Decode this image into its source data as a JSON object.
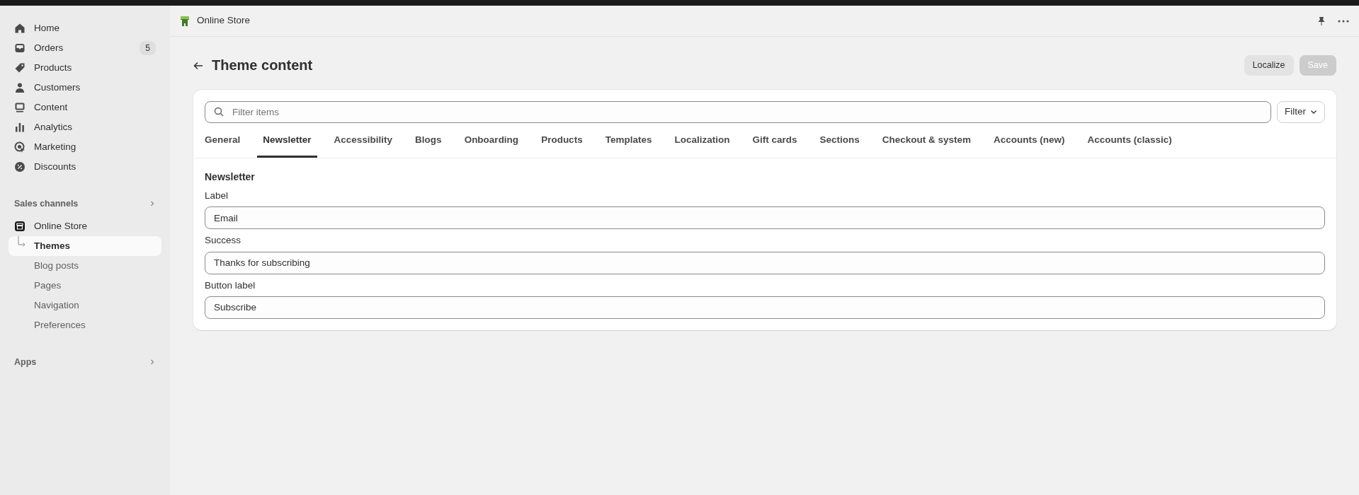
{
  "sidebar": {
    "items": [
      {
        "label": "Home"
      },
      {
        "label": "Orders",
        "badge": "5"
      },
      {
        "label": "Products"
      },
      {
        "label": "Customers"
      },
      {
        "label": "Content"
      },
      {
        "label": "Analytics"
      },
      {
        "label": "Marketing"
      },
      {
        "label": "Discounts"
      }
    ],
    "sections": [
      {
        "title": "Sales channels",
        "channels": [
          {
            "label": "Online Store",
            "children": [
              {
                "label": "Themes",
                "selected": true
              },
              {
                "label": "Blog posts",
                "selected": false
              },
              {
                "label": "Pages",
                "selected": false
              },
              {
                "label": "Navigation",
                "selected": false
              },
              {
                "label": "Preferences",
                "selected": false
              }
            ]
          }
        ]
      },
      {
        "title": "Apps"
      }
    ]
  },
  "topbar": {
    "title": "Online Store"
  },
  "page": {
    "title": "Theme content",
    "buttons": [
      {
        "label": "Localize",
        "disabled": false
      },
      {
        "label": "Save",
        "disabled": true
      }
    ]
  },
  "search": {
    "placeholder": "Filter items"
  },
  "filter_button": "Filter",
  "tabs": [
    {
      "label": "General",
      "selected": false
    },
    {
      "label": "Newsletter",
      "selected": true
    },
    {
      "label": "Accessibility",
      "selected": false
    },
    {
      "label": "Blogs",
      "selected": false
    },
    {
      "label": "Onboarding",
      "selected": false
    },
    {
      "label": "Products",
      "selected": false
    },
    {
      "label": "Templates",
      "selected": false
    },
    {
      "label": "Localization",
      "selected": false
    },
    {
      "label": "Gift cards",
      "selected": false
    },
    {
      "label": "Sections",
      "selected": false
    },
    {
      "label": "Checkout & system",
      "selected": false
    },
    {
      "label": "Accounts (new)",
      "selected": false
    },
    {
      "label": "Accounts (classic)",
      "selected": false
    }
  ],
  "section": {
    "title": "Newsletter",
    "fields": [
      {
        "label": "Label",
        "value": "Email"
      },
      {
        "label": "Success",
        "value": "Thanks for subscribing"
      },
      {
        "label": "Button label",
        "value": "Subscribe"
      }
    ]
  }
}
